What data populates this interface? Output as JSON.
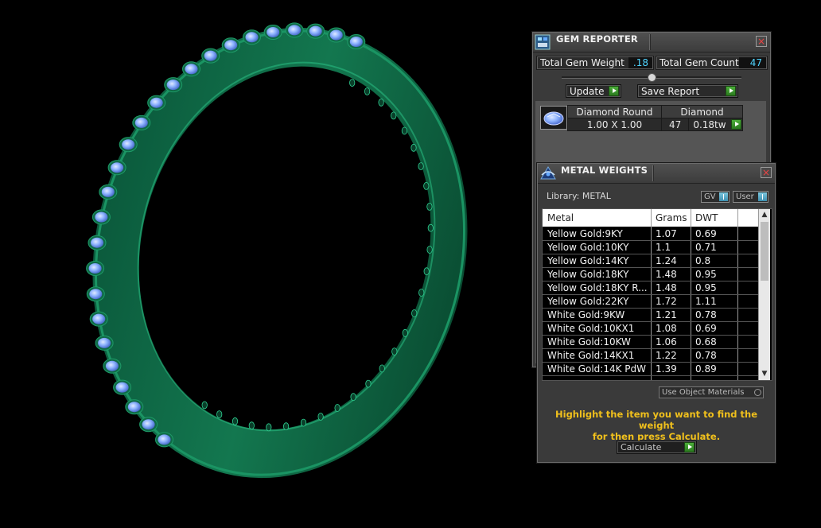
{
  "gem_reporter": {
    "title": "GEM REPORTER",
    "close": "×",
    "total_weight_label": "Total Gem Weight",
    "total_weight_value": ".18",
    "total_count_label": "Total Gem Count",
    "total_count_value": "47",
    "update_label": "Update",
    "save_report_label": "Save Report",
    "gem_row": {
      "shape": "Diamond Round",
      "material": "Diamond",
      "size": "1.00 X 1.00",
      "count": "47",
      "weight": "0.18tw"
    }
  },
  "metal_weights": {
    "title": "METAL WEIGHTS",
    "close": "×",
    "library_label": "Library: METAL",
    "gv_label": "GV",
    "user_label": "User",
    "columns": [
      "Metal",
      "Grams",
      "DWT"
    ],
    "rows": [
      {
        "metal": "Yellow Gold:9KY",
        "grams": "1.07",
        "dwt": "0.69"
      },
      {
        "metal": "Yellow Gold:10KY",
        "grams": "1.1",
        "dwt": "0.71"
      },
      {
        "metal": "Yellow Gold:14KY",
        "grams": "1.24",
        "dwt": "0.8"
      },
      {
        "metal": "Yellow Gold:18KY",
        "grams": "1.48",
        "dwt": "0.95"
      },
      {
        "metal": "Yellow Gold:18KY R...",
        "grams": "1.48",
        "dwt": "0.95"
      },
      {
        "metal": "Yellow Gold:22KY",
        "grams": "1.72",
        "dwt": "1.11"
      },
      {
        "metal": "White Gold:9KW",
        "grams": "1.21",
        "dwt": "0.78"
      },
      {
        "metal": "White Gold:10KX1",
        "grams": "1.08",
        "dwt": "0.69"
      },
      {
        "metal": "White Gold:10KW",
        "grams": "1.06",
        "dwt": "0.68"
      },
      {
        "metal": "White Gold:14KX1",
        "grams": "1.22",
        "dwt": "0.78"
      },
      {
        "metal": "White Gold:14K PdW",
        "grams": "1.39",
        "dwt": "0.89"
      }
    ],
    "use_object_materials_label": "Use Object Materials",
    "hint_line1": "Highlight the item you want to find the weight",
    "hint_line2": "for then press Calculate.",
    "calculate_label": "Calculate"
  },
  "colors": {
    "ring_green": "#0f6a47",
    "gem_blue": "#8fb4ff",
    "value_cyan": "#4fd4ff",
    "hint_yellow": "#f0c01c",
    "go_green": "#3c9a2c"
  },
  "icons": [
    "gem-reporter-icon",
    "metal-weights-icon",
    "diamond-thumbnail-icon",
    "close-icon",
    "go-arrow-icon"
  ]
}
